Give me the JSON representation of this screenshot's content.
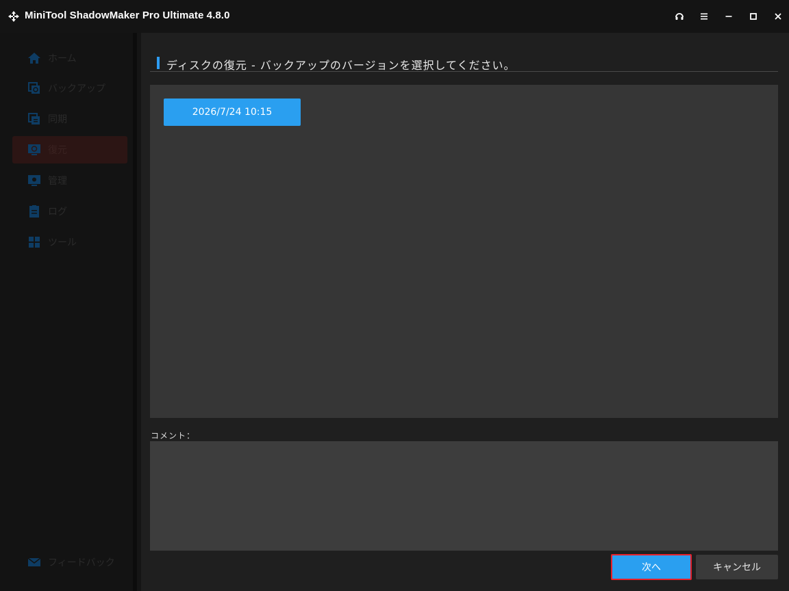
{
  "app": {
    "title": "MiniTool ShadowMaker Pro Ultimate 4.8.0"
  },
  "titlebar": {
    "buttons": [
      {
        "name": "headset-icon"
      },
      {
        "name": "menu-icon"
      },
      {
        "name": "minimize-icon"
      },
      {
        "name": "maximize-icon"
      },
      {
        "name": "close-icon"
      }
    ]
  },
  "sidebar": {
    "items": [
      {
        "label": "ホーム",
        "icon": "home-icon"
      },
      {
        "label": "バックアップ",
        "icon": "backup-icon"
      },
      {
        "label": "同期",
        "icon": "sync-icon"
      },
      {
        "label": "復元",
        "icon": "restore-icon",
        "active": true
      },
      {
        "label": "管理",
        "icon": "manage-icon"
      },
      {
        "label": "ログ",
        "icon": "log-icon"
      },
      {
        "label": "ツール",
        "icon": "tools-icon"
      }
    ],
    "feedback": {
      "label": "フィードバック",
      "icon": "mail-icon"
    }
  },
  "main": {
    "title": "ディスクの復元 - バックアップのバージョンを選択してください。",
    "versions": [
      "2026/7/24 10:15"
    ],
    "comment_label": "コメント：",
    "comment_value": "",
    "next_label": "次へ",
    "cancel_label": "キャンセル"
  },
  "colors": {
    "accent": "#2a9ff0",
    "highlight_border": "#e8202a",
    "panel": "#363636",
    "background": "#1f1f1f"
  }
}
